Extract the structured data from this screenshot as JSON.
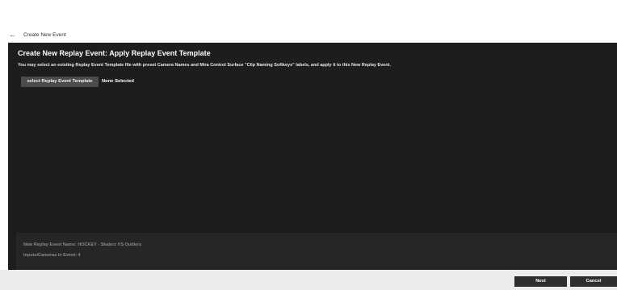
{
  "titlebar": {
    "back_icon": "←",
    "title": "Create New Event"
  },
  "panel": {
    "heading": "Create New Replay Event: Apply Replay Event Template",
    "description": "You may select an existing Replay Event Template file with preset Camera Names and Mira Control Surface \"Clip Naming Softkeys\" labels, and apply it to this New Replay Event.",
    "select_button_label": "select Replay Event Template",
    "selected_value": "None Selected"
  },
  "summary": {
    "event_name_line": "New Replay Event Name: HOCKEY - Skaterz VS Outliers",
    "inputs_line": "Inputs/Cameras in Event: 4"
  },
  "footer": {
    "next_label": "Next",
    "cancel_label": "Cancel"
  }
}
